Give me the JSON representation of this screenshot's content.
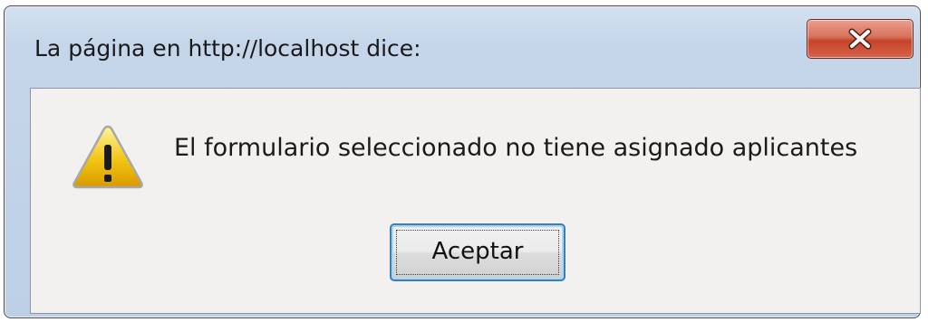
{
  "dialog": {
    "title": "La página en http://localhost dice:",
    "message": "El formulario seleccionado no tiene asignado aplicantes",
    "ok_label": "Aceptar",
    "icons": {
      "close": "close-icon",
      "warning": "warning-icon"
    },
    "colors": {
      "close_button": "#c4432a",
      "warning_fill": "#f2c511",
      "ok_border": "#3c7fb1"
    }
  }
}
